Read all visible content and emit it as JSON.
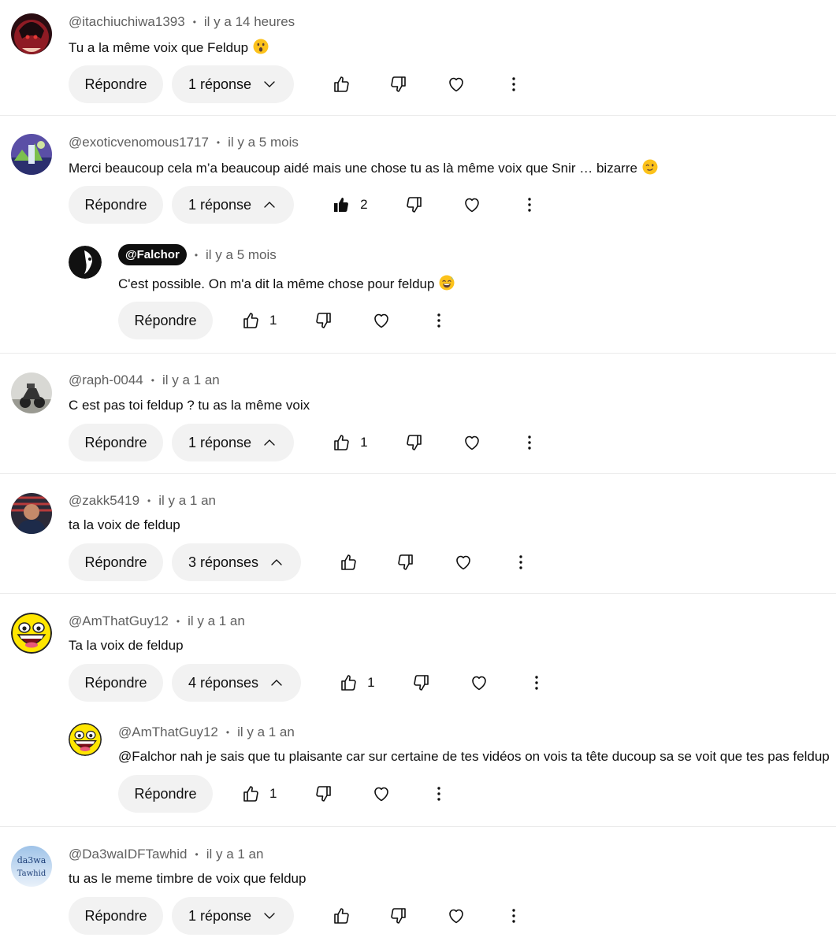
{
  "ui": {
    "reply_label": "Répondre"
  },
  "comments": [
    {
      "author": "@itachiuchiwa1393",
      "time": "il y a 14 heures",
      "text": "Tu a la même voix que Feldup",
      "emoji": "astonished-face",
      "likes": "",
      "replies_label": "1 réponse",
      "replies_expanded": false
    },
    {
      "author": "@exoticvenomous1717",
      "time": "il y a 5 mois",
      "text": "Merci beaucoup cela m’a beaucoup aidé mais une chose tu as là même voix que Snir … bizarre",
      "emoji": "winking-face",
      "likes": "2",
      "liked": true,
      "replies_label": "1 réponse",
      "replies_expanded": true,
      "replies": [
        {
          "author": "@Falchor",
          "is_channel_owner": true,
          "time": "il y a 5 mois",
          "text": "C'est possible. On m'a dit la même chose pour feldup",
          "emoji": "grinning-sweat-face",
          "likes": "1"
        }
      ]
    },
    {
      "author": "@raph-0044",
      "time": "il y a 1 an",
      "text": "C est pas toi feldup ? tu as la même voix",
      "likes": "1",
      "replies_label": "1 réponse",
      "replies_expanded": true
    },
    {
      "author": "@zakk5419",
      "time": "il y a 1 an",
      "text": "ta la voix de feldup",
      "likes": "",
      "replies_label": "3 réponses",
      "replies_expanded": true
    },
    {
      "author": "@AmThatGuy12",
      "time": "il y a 1 an",
      "text": "Ta la voix de feldup",
      "likes": "1",
      "replies_label": "4 réponses",
      "replies_expanded": true,
      "replies": [
        {
          "author": "@AmThatGuy12",
          "time": "il y a 1 an",
          "text": "@Falchor nah je sais que tu plaisante car sur certaine de tes vidéos on vois ta tête ducoup sa se voit que tes pas feldup",
          "likes": "1"
        }
      ]
    },
    {
      "author": "@Da3waIDFTawhid",
      "time": "il y a 1 an",
      "text": "tu as le meme timbre de voix que feldup",
      "likes": "",
      "replies_label": "1 réponse",
      "replies_expanded": false,
      "avatar_text": [
        "da3wa",
        "Tawhid"
      ]
    }
  ],
  "colors": {
    "pill_bg": "#f2f2f2",
    "meta_text": "#606060",
    "body_text": "#0f0f0f",
    "separator": "#ebebeb",
    "owner_badge_bg": "#0f0f0f"
  }
}
